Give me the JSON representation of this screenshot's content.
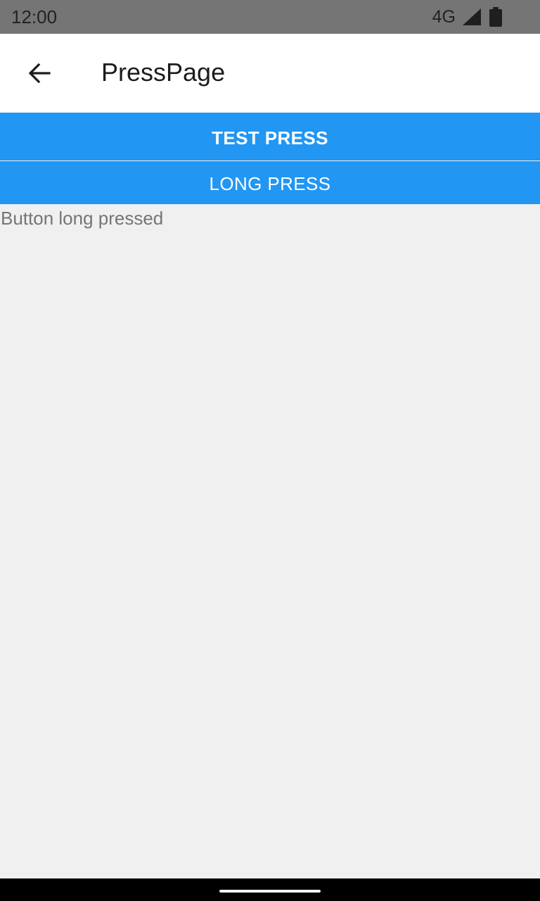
{
  "status_bar": {
    "time": "12:00",
    "network": "4G",
    "signal_icon": "signal-icon",
    "battery_icon": "battery-icon"
  },
  "app_bar": {
    "title": "PressPage",
    "back_icon": "back-arrow-icon"
  },
  "buttons": {
    "test_press_label": "TEST PRESS",
    "long_press_label": "LONG PRESS"
  },
  "result": {
    "message": "Button long pressed"
  },
  "colors": {
    "status_bar": "#757575",
    "app_bar": "#ffffff",
    "button": "#2196f3",
    "page_background": "#f0f0f0",
    "message_text": "#757575"
  }
}
